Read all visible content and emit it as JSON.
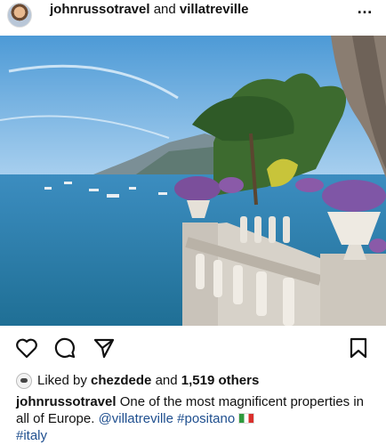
{
  "post": {
    "author": "johnrussotravel",
    "connector": "and",
    "collaborator": "villatreville",
    "more_icon": "…"
  },
  "icons": {
    "like": "heart-icon",
    "comment": "comment-icon",
    "share": "send-icon",
    "save": "bookmark-icon"
  },
  "likes": {
    "prefix": "Liked by",
    "user": "chezdede",
    "middle": "and",
    "count_text": "1,519 others"
  },
  "caption": {
    "author": "johnrussotravel",
    "text": "One of the most magnificent properties in all of Europe.",
    "mention": "@villatreville",
    "hashtag1": "#positano",
    "hashtag2": "#italy"
  },
  "colors": {
    "link": "#1f4f8f",
    "sea": "#2b86b9",
    "sky": "#5da8de"
  }
}
